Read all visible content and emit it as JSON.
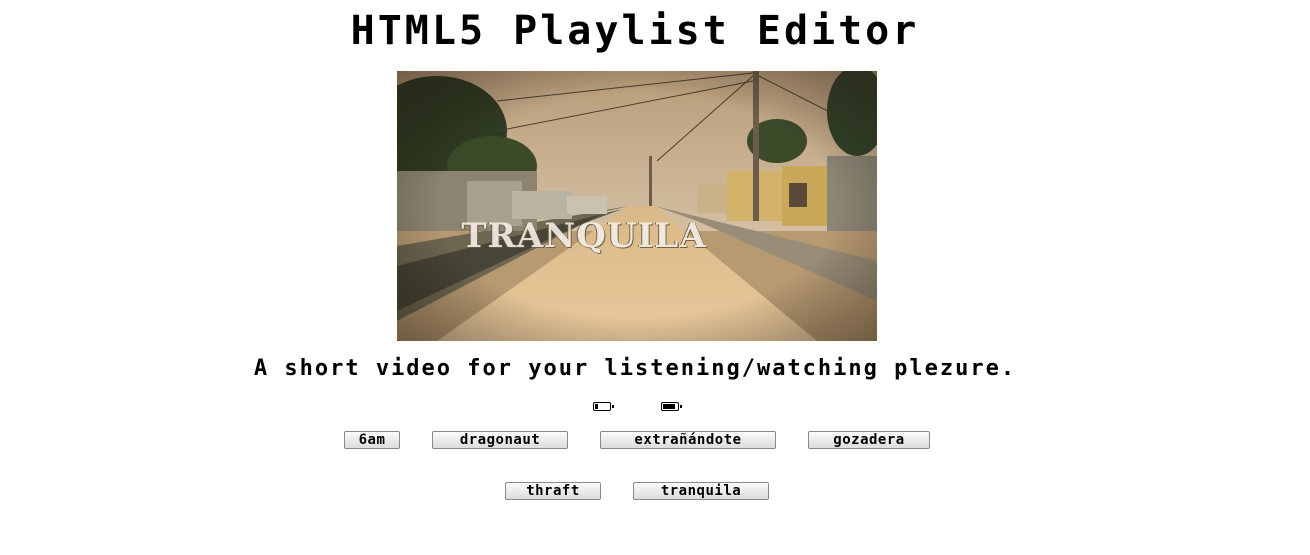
{
  "page": {
    "title": "HTML5 Playlist Editor",
    "description": "A short video for your listening/watching plezure."
  },
  "video": {
    "caption": "TRANQUILA",
    "icons": [
      "battery-low-icon",
      "battery-full-icon"
    ],
    "levels": {
      "low": 0.2,
      "full": 0.9
    }
  },
  "playlist": {
    "items": [
      {
        "label": "6am"
      },
      {
        "label": "dragonaut"
      },
      {
        "label": "extrañándote"
      },
      {
        "label": "gozadera"
      },
      {
        "label": "thraft"
      },
      {
        "label": "tranquila"
      }
    ]
  },
  "colors": {
    "background": "#ffffff",
    "text": "#000000",
    "button_bg": "#e8e8e8",
    "button_border": "#8a8a8a"
  }
}
